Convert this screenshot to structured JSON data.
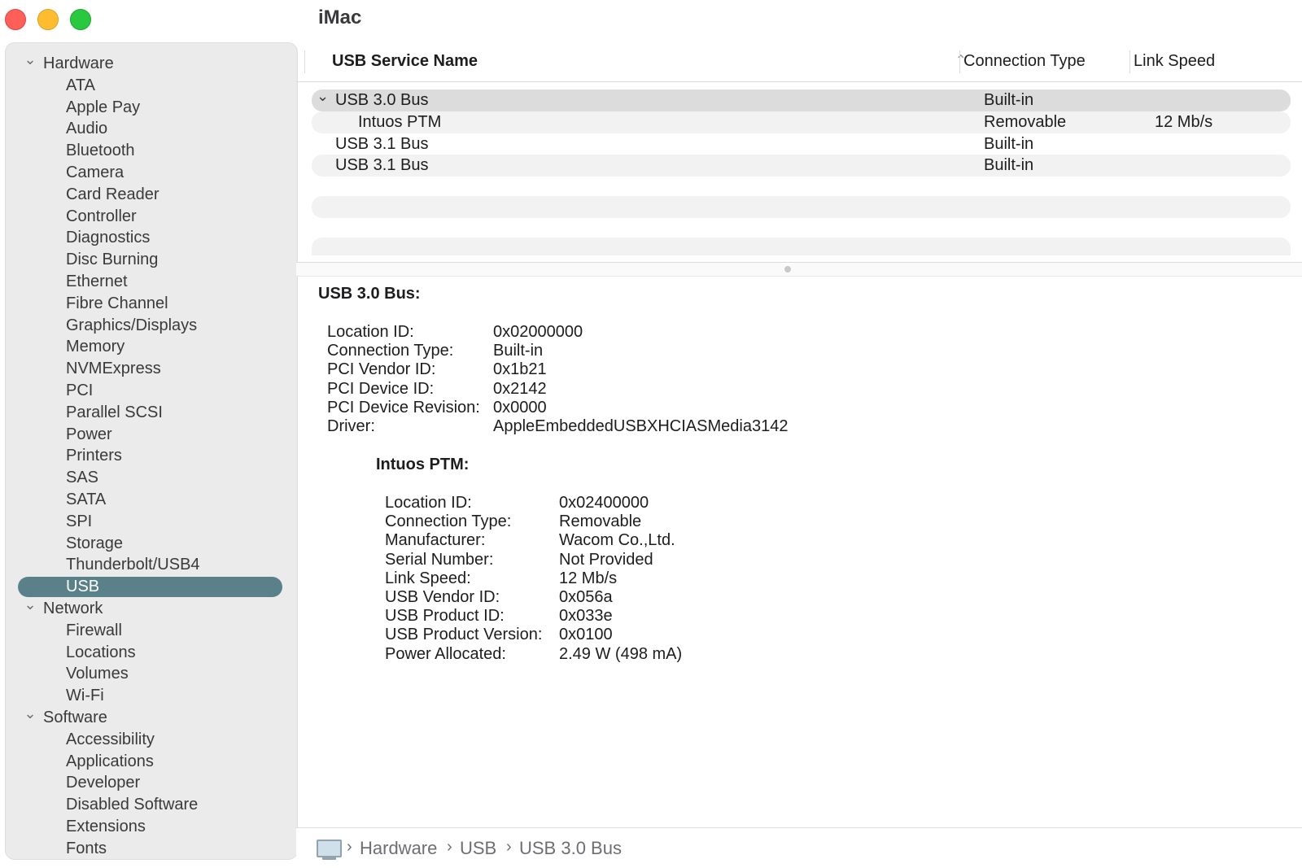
{
  "window": {
    "title": "iMac"
  },
  "sidebar": {
    "groups": [
      {
        "label": "Hardware",
        "items": [
          "ATA",
          "Apple Pay",
          "Audio",
          "Bluetooth",
          "Camera",
          "Card Reader",
          "Controller",
          "Diagnostics",
          "Disc Burning",
          "Ethernet",
          "Fibre Channel",
          "Graphics/Displays",
          "Memory",
          "NVMExpress",
          "PCI",
          "Parallel SCSI",
          "Power",
          "Printers",
          "SAS",
          "SATA",
          "SPI",
          "Storage",
          "Thunderbolt/USB4",
          "USB"
        ]
      },
      {
        "label": "Network",
        "items": [
          "Firewall",
          "Locations",
          "Volumes",
          "Wi-Fi"
        ]
      },
      {
        "label": "Software",
        "items": [
          "Accessibility",
          "Applications",
          "Developer",
          "Disabled Software",
          "Extensions",
          "Fonts"
        ]
      }
    ],
    "selected": "USB"
  },
  "list": {
    "headers": {
      "name": "USB Service Name",
      "type": "Connection Type",
      "speed": "Link Speed"
    },
    "rows": [
      {
        "name": "USB 3.0 Bus",
        "type": "Built-in",
        "speed": ""
      },
      {
        "name": "Intuos PTM",
        "type": "Removable",
        "speed": "12 Mb/s"
      },
      {
        "name": "USB 3.1 Bus",
        "type": "Built-in",
        "speed": ""
      },
      {
        "name": "USB 3.1 Bus",
        "type": "Built-in",
        "speed": ""
      }
    ]
  },
  "detail": {
    "bus": {
      "title": "USB 3.0 Bus:",
      "fields": [
        {
          "k": "Location ID:",
          "v": "0x02000000"
        },
        {
          "k": "Connection Type:",
          "v": "Built-in"
        },
        {
          "k": "PCI Vendor ID:",
          "v": "0x1b21"
        },
        {
          "k": "PCI Device ID:",
          "v": "0x2142"
        },
        {
          "k": "PCI Device Revision:",
          "v": "0x0000"
        },
        {
          "k": "Driver:",
          "v": "AppleEmbeddedUSBXHCIASMedia3142"
        }
      ]
    },
    "device": {
      "title": "Intuos PTM:",
      "fields": [
        {
          "k": "Location ID:",
          "v": "0x02400000"
        },
        {
          "k": "Connection Type:",
          "v": "Removable"
        },
        {
          "k": "Manufacturer:",
          "v": "Wacom Co.,Ltd."
        },
        {
          "k": "Serial Number:",
          "v": "Not Provided"
        },
        {
          "k": "Link Speed:",
          "v": "12 Mb/s"
        },
        {
          "k": "USB Vendor ID:",
          "v": "0x056a"
        },
        {
          "k": "USB Product ID:",
          "v": "0x033e"
        },
        {
          "k": "USB Product Version:",
          "v": "0x0100"
        },
        {
          "k": "Power Allocated:",
          "v": "2.49 W (498 mA)"
        }
      ]
    }
  },
  "breadcrumb": [
    "Hardware",
    "USB",
    "USB 3.0 Bus"
  ],
  "icons": {
    "chevron": "chevron-down-icon",
    "sort": "sort-up-icon",
    "computer": "imac-icon"
  },
  "colors": {
    "selection": "#5a8189",
    "close": "#fe5f57",
    "minimize": "#febc2e",
    "maximize": "#28c840"
  }
}
